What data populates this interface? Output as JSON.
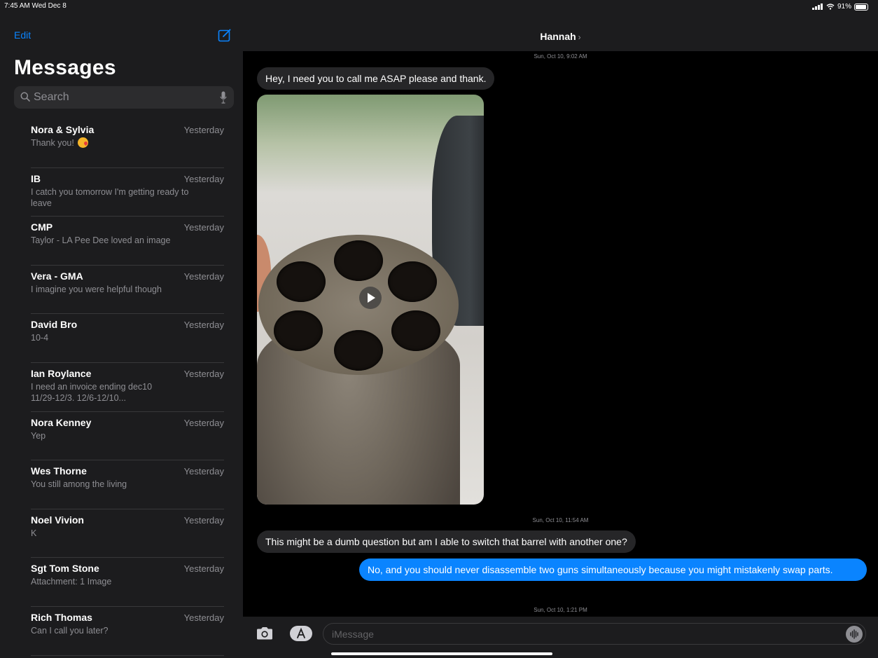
{
  "status": {
    "time_date": "7:45 AM  Wed Dec 8",
    "battery": "91%",
    "battery_level": 0.91
  },
  "sidebar": {
    "edit_label": "Edit",
    "title": "Messages",
    "search_placeholder": "Search",
    "conversations": [
      {
        "name": "Nora & Sylvia",
        "time": "Yesterday",
        "preview": "Thank you!",
        "emoji": "kissing-face-emoji"
      },
      {
        "name": "IB",
        "time": "Yesterday",
        "preview": "I catch you tomorrow I'm getting ready to leave"
      },
      {
        "name": "CMP",
        "time": "Yesterday",
        "preview": "Taylor - LA Pee Dee loved an image"
      },
      {
        "name": "Vera - GMA",
        "time": "Yesterday",
        "preview": "I imagine you were helpful though"
      },
      {
        "name": "David Bro",
        "time": "Yesterday",
        "preview": "10-4"
      },
      {
        "name": "Ian Roylance",
        "time": "Yesterday",
        "preview": "I need an invoice ending dec10 11/29-12/3. 12/6-12/10..."
      },
      {
        "name": "Nora Kenney",
        "time": "Yesterday",
        "preview": "Yep"
      },
      {
        "name": "Wes Thorne",
        "time": "Yesterday",
        "preview": "You still among the living"
      },
      {
        "name": "Noel Vivion",
        "time": "Yesterday",
        "preview": "K"
      },
      {
        "name": "Sgt Tom Stone",
        "time": "Yesterday",
        "preview": "Attachment: 1 Image"
      },
      {
        "name": "Rich Thomas",
        "time": "Yesterday",
        "preview": "Can I call you later?"
      }
    ]
  },
  "chat": {
    "contact_name": "Hannah",
    "timestamps": [
      "Sun, Oct 10, 9:02 AM",
      "Sun, Oct 10, 11:54 AM",
      "Sun, Oct 10, 1:21 PM"
    ],
    "messages": [
      {
        "direction": "incoming",
        "text": "Hey, I need you to call me ASAP please and thank."
      },
      {
        "direction": "incoming",
        "type": "video",
        "text": ""
      },
      {
        "direction": "incoming",
        "text": "This might be a dumb question but am I able to switch that barrel with another one?"
      },
      {
        "direction": "outgoing",
        "text": "No, and you should never disassemble two guns simultaneously because you might mistakenly swap parts."
      }
    ],
    "input_placeholder": "iMessage"
  },
  "colors": {
    "accent": "#0a84ff",
    "outgoing_bubble": "#0a84ff",
    "incoming_bubble": "#262628",
    "sidebar_bg": "#1c1c1e"
  }
}
